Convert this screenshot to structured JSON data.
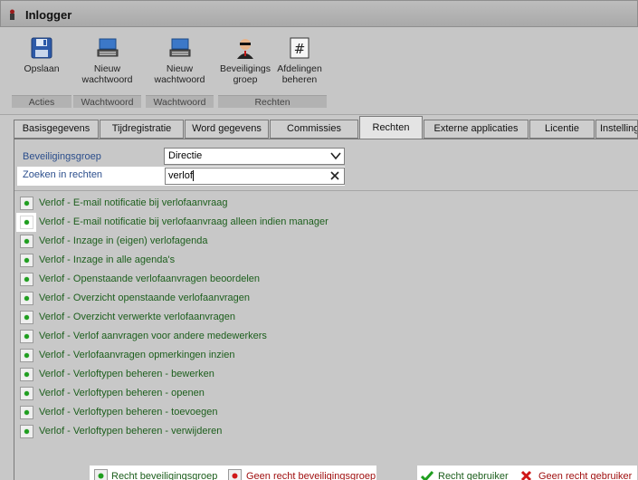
{
  "window": {
    "title": "Inlogger"
  },
  "ribbon": {
    "groups": [
      {
        "label": "Acties",
        "buttons": [
          {
            "label": "Opslaan",
            "icon": "save-icon"
          }
        ]
      },
      {
        "label": "Wachtwoord",
        "buttons": [
          {
            "label": "Nieuw wachtwoord",
            "icon": "keyboard-icon"
          }
        ]
      },
      {
        "label": "Wachtwoord",
        "buttons": [
          {
            "label": "Nieuw wachtwoord",
            "icon": "keyboard-icon"
          }
        ]
      },
      {
        "label": "Rechten",
        "buttons": [
          {
            "label": "Beveiligings groep",
            "icon": "security-agent-icon"
          },
          {
            "label": "Afdelingen beheren",
            "icon": "hash-icon"
          }
        ]
      }
    ]
  },
  "tabs": [
    {
      "label": "Basisgegevens",
      "active": false
    },
    {
      "label": "Tijdregistratie",
      "active": false
    },
    {
      "label": "Word gegevens",
      "active": false
    },
    {
      "label": "Commissies",
      "active": false
    },
    {
      "label": "Rechten",
      "active": true
    },
    {
      "label": "Externe applicaties",
      "active": false
    },
    {
      "label": "Licentie",
      "active": false
    },
    {
      "label": "Instellingen",
      "active": false
    }
  ],
  "form": {
    "group_label": "Beveiligingsgroep",
    "group_value": "Directie",
    "search_label": "Zoeken in rechten",
    "search_value": "verlof"
  },
  "rights": [
    "Verlof - E-mail notificatie bij verlofaanvraag",
    "Verlof - E-mail notificatie bij verlofaanvraag alleen indien manager",
    "Verlof - Inzage in (eigen) verlofagenda",
    "Verlof - Inzage in alle agenda's",
    "Verlof - Openstaande verlofaanvragen beoordelen",
    "Verlof - Overzicht openstaande verlofaanvragen",
    "Verlof - Overzicht verwerkte verlofaanvragen",
    "Verlof - Verlof aanvragen voor andere medewerkers",
    "Verlof - Verlofaanvragen opmerkingen inzien",
    "Verlof - Verloftypen beheren - bewerken",
    "Verlof - Verloftypen beheren - openen",
    "Verlof - Verloftypen beheren - toevoegen",
    "Verlof - Verloftypen beheren - verwijderen"
  ],
  "legend": {
    "group_right": "Recht beveiligingsgroep",
    "group_no_right": "Geen recht beveiligingsgroep",
    "user_right": "Recht gebruiker",
    "user_no_right": "Geen recht gebruiker"
  },
  "colors": {
    "label_blue": "#2b4e8c",
    "right_green": "#1c5e1c",
    "no_right_red": "#a01010",
    "dot_green": "#1f9e1f",
    "dot_red": "#d01818"
  }
}
